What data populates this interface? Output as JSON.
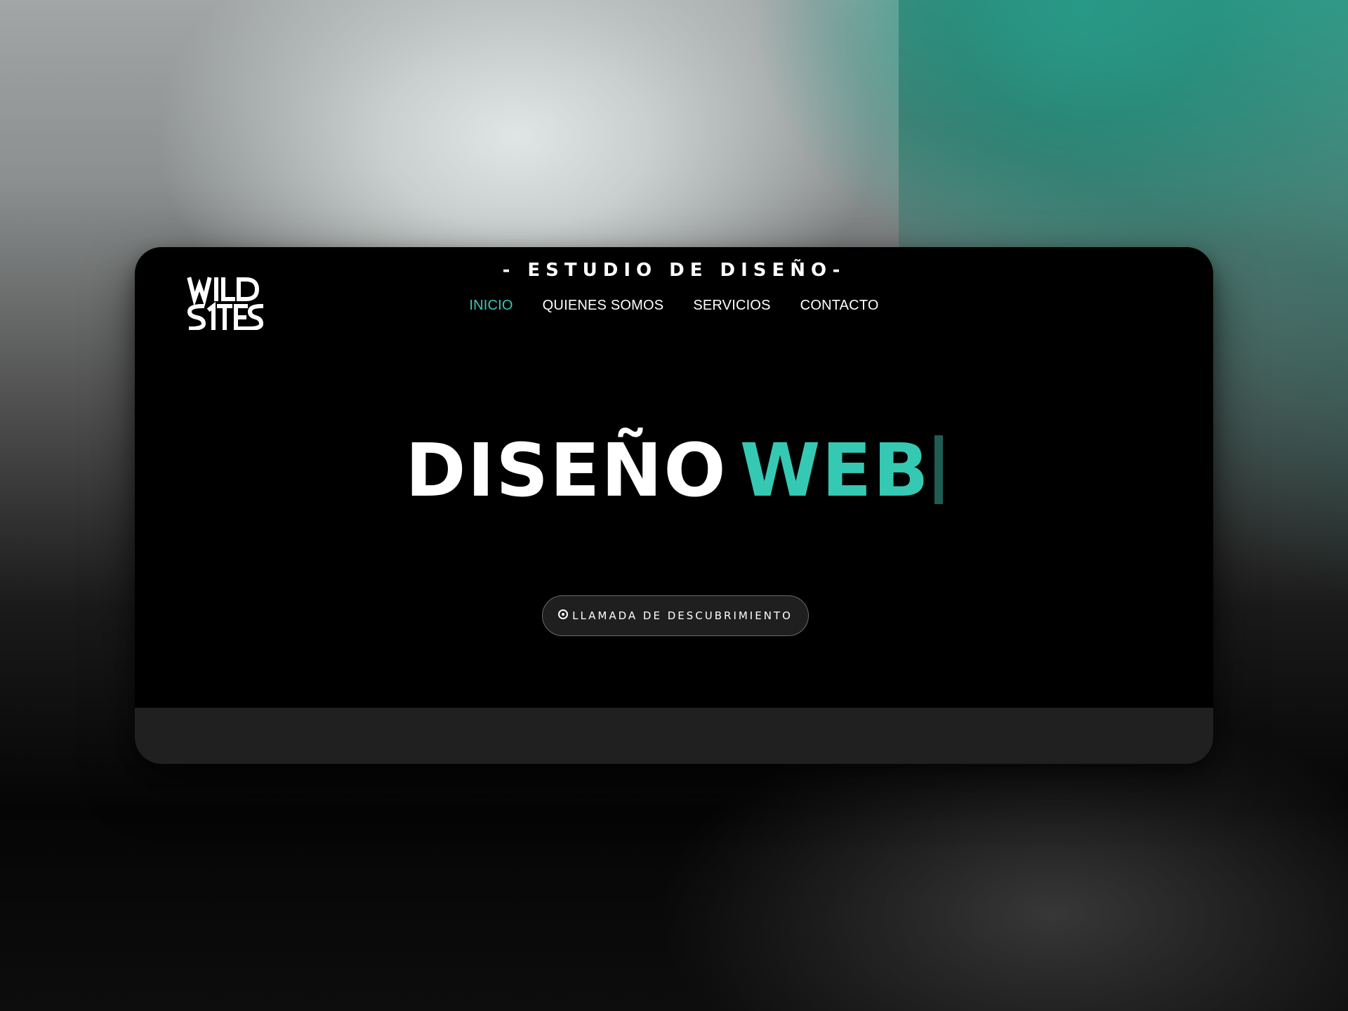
{
  "brand": {
    "logo_text": "WILD SITES",
    "tagline": "- ESTUDIO DE DISEÑO-"
  },
  "nav": {
    "items": [
      {
        "label": "INICIO",
        "active": true
      },
      {
        "label": "QUIENES SOMOS",
        "active": false
      },
      {
        "label": "SERVICIOS",
        "active": false
      },
      {
        "label": "CONTACTO",
        "active": false
      }
    ]
  },
  "hero": {
    "word1": "DISEÑO",
    "word2": "WEB"
  },
  "cta": {
    "icon": "record-icon",
    "label": "LLAMADA DE DESCUBRIMIENTO"
  },
  "colors": {
    "accent": "#35c9b3",
    "page_bg": "#000000",
    "footer_band": "#202020",
    "cursor": "#1f5d54"
  }
}
